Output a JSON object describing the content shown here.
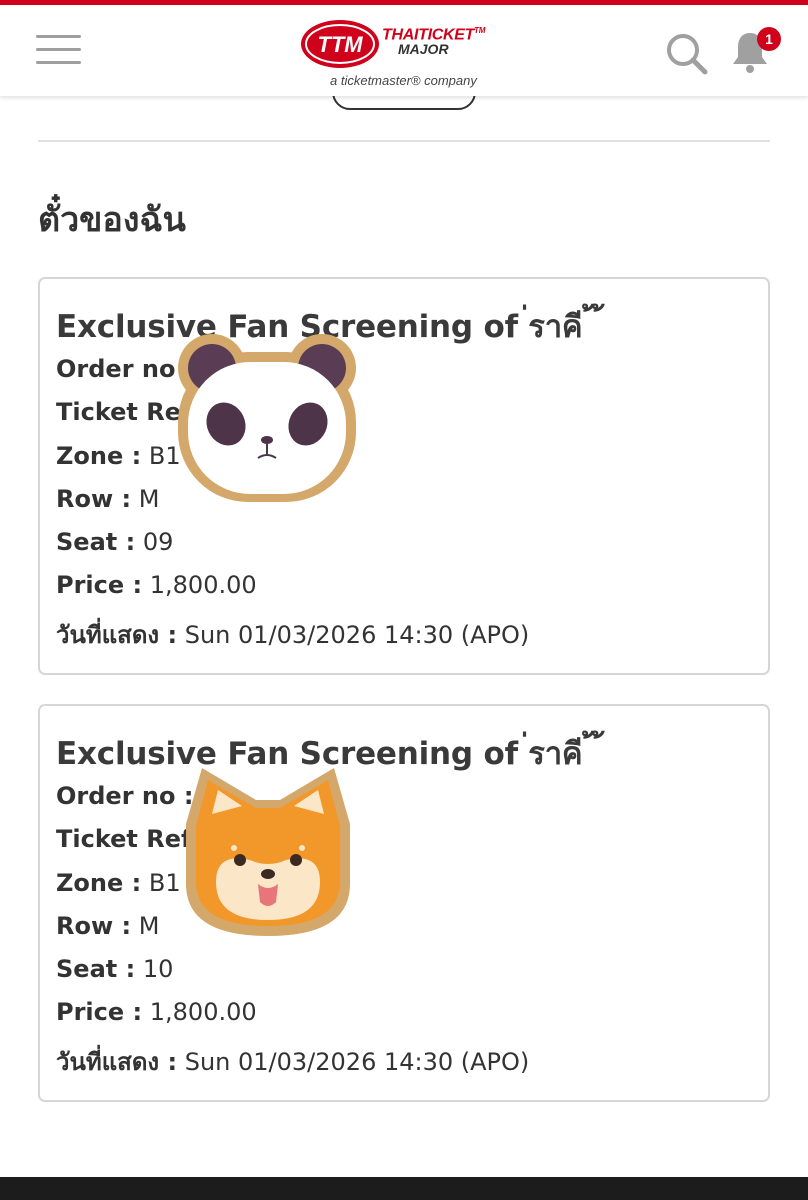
{
  "colors": {
    "accent": "#d0021b",
    "footer": "#1c1c1c",
    "card_border": "#d6d6d6"
  },
  "header": {
    "menu_icon": "hamburger-icon",
    "logo": {
      "line1": "THAITICKET",
      "tm": "TM",
      "line2": "MAJOR",
      "tagline": "a ticketmaster® company"
    },
    "search_icon": "search-icon",
    "notification_icon": "bell-icon",
    "notification_count": "1"
  },
  "page": {
    "title": "ตั๋วของฉัน"
  },
  "tickets": [
    {
      "event_name": "Exclusive Fan Screening of ่ราคี ้ ้",
      "order_label": "Order no",
      "order_value": "",
      "ref_label": "Ticket Ref",
      "ref_value": "",
      "zone_label": "Zone :",
      "zone_value": "B1",
      "row_label": "Row :",
      "row_value": "M",
      "seat_label": "Seat :",
      "seat_value": "09",
      "price_label": "Price :",
      "price_value": "1,800.00",
      "date_label": "วันที่แสดง :",
      "date_value": "Sun 01/03/2026 14:30 (APO)",
      "sticker": "panda-sticker"
    },
    {
      "event_name": "Exclusive Fan Screening of ่ราคี ้ ้",
      "order_label": "Order no :",
      "order_value": "",
      "ref_label": "Ticket Ref",
      "ref_value": "",
      "zone_label": "Zone :",
      "zone_value": "B1",
      "row_label": "Row :",
      "row_value": "M",
      "seat_label": "Seat :",
      "seat_value": "10",
      "price_label": "Price :",
      "price_value": "1,800.00",
      "date_label": "วันที่แสดง :",
      "date_value": "Sun 01/03/2026 14:30 (APO)",
      "sticker": "shiba-dog-sticker"
    }
  ]
}
